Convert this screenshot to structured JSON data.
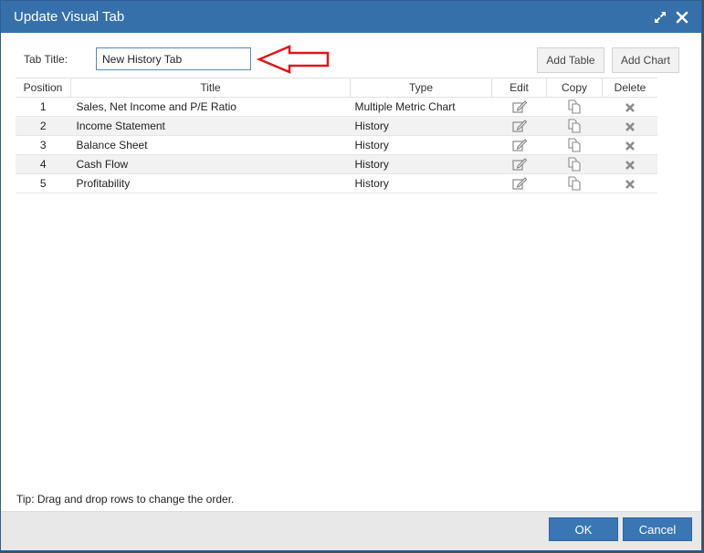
{
  "dialog": {
    "title": "Update Visual Tab"
  },
  "form": {
    "tab_title_label": "Tab Title:",
    "tab_title_value": "New History Tab",
    "add_table_label": "Add Table",
    "add_chart_label": "Add Chart"
  },
  "table": {
    "headers": {
      "position": "Position",
      "title": "Title",
      "type": "Type",
      "edit": "Edit",
      "copy": "Copy",
      "delete": "Delete"
    },
    "rows": [
      {
        "position": "1",
        "title": "Sales, Net Income and P/E Ratio",
        "type": "Multiple Metric Chart"
      },
      {
        "position": "2",
        "title": "Income Statement",
        "type": "History"
      },
      {
        "position": "3",
        "title": "Balance Sheet",
        "type": "History"
      },
      {
        "position": "4",
        "title": "Cash Flow",
        "type": "History"
      },
      {
        "position": "5",
        "title": "Profitability",
        "type": "History"
      }
    ]
  },
  "tip": "Tip: Drag and drop rows to change the order.",
  "footer": {
    "ok_label": "OK",
    "cancel_label": "Cancel"
  },
  "colors": {
    "titlebar": "#3570aa",
    "primary_button": "#3a76b4",
    "annotation_arrow": "#e0161b"
  },
  "icons": [
    "maximize-icon",
    "close-icon",
    "edit-icon",
    "copy-icon",
    "delete-icon",
    "arrow-annotation-icon"
  ]
}
